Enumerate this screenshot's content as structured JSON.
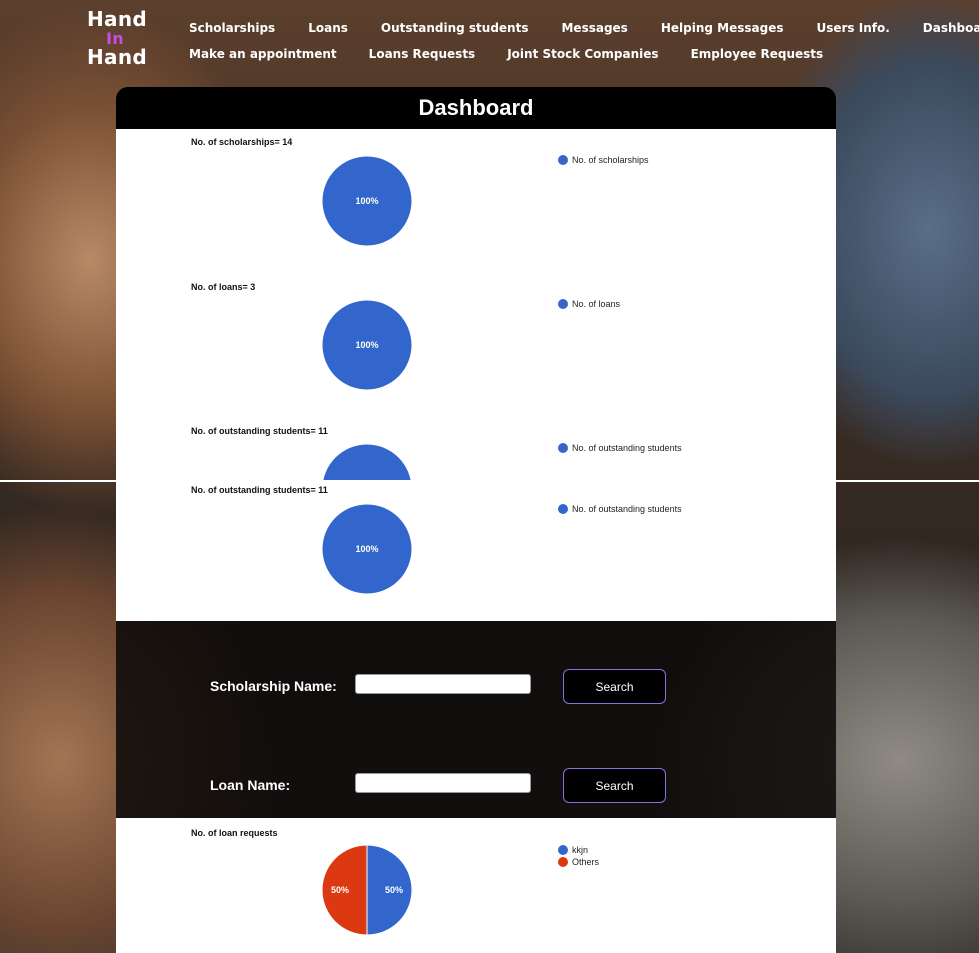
{
  "brand": {
    "line1": "Hand",
    "line2": "In",
    "line3": "Hand",
    "accent": "#c24fe0"
  },
  "nav": {
    "row1": [
      "Scholarships",
      "Loans",
      "Outstanding students",
      "Messages",
      "Helping Messages",
      "Users Info.",
      "Dashboard"
    ],
    "row2": [
      "Make an appointment",
      "Loans Requests",
      "Joint Stock Companies",
      "Employee Requests"
    ]
  },
  "dashboard": {
    "title": "Dashboard"
  },
  "colors": {
    "blue": "#3366cc",
    "red": "#dc3912",
    "button_border": "#8a6ee0"
  },
  "charts": {
    "scholarships": {
      "title": "No. of scholarships= 14",
      "slices": [
        {
          "label": "No. of scholarships",
          "value": 14,
          "percent": "100%"
        }
      ]
    },
    "loans": {
      "title": "No. of loans= 3",
      "slices": [
        {
          "label": "No. of loans",
          "value": 3,
          "percent": "100%"
        }
      ]
    },
    "outstanding": {
      "title": "No. of outstanding students= 11",
      "slices": [
        {
          "label": "No. of outstanding students",
          "value": 11,
          "percent": "100%"
        }
      ]
    },
    "loan_requests": {
      "title": "No. of loan requests",
      "slices": [
        {
          "label": "kkjn",
          "value": 1,
          "percent": "50%"
        },
        {
          "label": "Others",
          "value": 1,
          "percent": "50%"
        }
      ]
    }
  },
  "search": {
    "scholarship_label": "Scholarship Name:",
    "scholarship_value": "",
    "loan_label": "Loan Name:",
    "loan_value": "",
    "button_label": "Search"
  },
  "chart_data": [
    {
      "type": "pie",
      "title": "No. of scholarships= 14",
      "categories": [
        "No. of scholarships"
      ],
      "values": [
        14
      ]
    },
    {
      "type": "pie",
      "title": "No. of loans= 3",
      "categories": [
        "No. of loans"
      ],
      "values": [
        3
      ]
    },
    {
      "type": "pie",
      "title": "No. of outstanding students= 11",
      "categories": [
        "No. of outstanding students"
      ],
      "values": [
        11
      ]
    },
    {
      "type": "pie",
      "title": "No. of loan requests",
      "categories": [
        "kkjn",
        "Others"
      ],
      "values": [
        1,
        1
      ]
    }
  ]
}
